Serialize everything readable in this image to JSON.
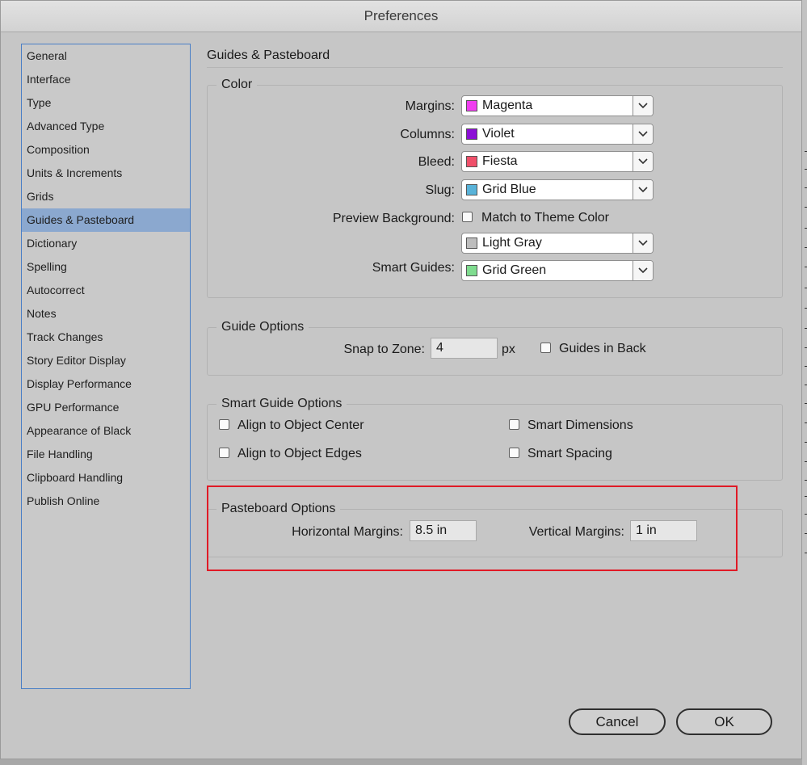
{
  "window": {
    "title": "Preferences"
  },
  "sidebar": {
    "items": [
      {
        "label": "General"
      },
      {
        "label": "Interface"
      },
      {
        "label": "Type"
      },
      {
        "label": "Advanced Type"
      },
      {
        "label": "Composition"
      },
      {
        "label": "Units & Increments"
      },
      {
        "label": "Grids"
      },
      {
        "label": "Guides & Pasteboard",
        "selected": true
      },
      {
        "label": "Dictionary"
      },
      {
        "label": "Spelling"
      },
      {
        "label": "Autocorrect"
      },
      {
        "label": "Notes"
      },
      {
        "label": "Track Changes"
      },
      {
        "label": "Story Editor Display"
      },
      {
        "label": "Display Performance"
      },
      {
        "label": "GPU Performance"
      },
      {
        "label": "Appearance of Black"
      },
      {
        "label": "File Handling"
      },
      {
        "label": "Clipboard Handling"
      },
      {
        "label": "Publish Online"
      }
    ]
  },
  "panel": {
    "title": "Guides & Pasteboard",
    "color": {
      "legend": "Color",
      "margins": {
        "label": "Margins:",
        "value": "Magenta",
        "swatch": "#f03ef0"
      },
      "columns": {
        "label": "Columns:",
        "value": "Violet",
        "swatch": "#8c0fd6"
      },
      "bleed": {
        "label": "Bleed:",
        "value": "Fiesta",
        "swatch": "#f0506a"
      },
      "slug": {
        "label": "Slug:",
        "value": "Grid Blue",
        "swatch": "#59b3d9"
      },
      "preview_background": {
        "label": "Preview Background:",
        "match_label": "Match to Theme Color",
        "match_checked": false,
        "value": "Light Gray",
        "swatch": "#bdbdbd"
      },
      "smart_guides": {
        "label": "Smart Guides:",
        "value": "Grid Green",
        "swatch": "#7fdc8f"
      }
    },
    "guide_options": {
      "legend": "Guide Options",
      "snap_label": "Snap to Zone:",
      "snap_value": "4",
      "snap_unit": "px",
      "guides_in_back_label": "Guides in Back",
      "guides_in_back_checked": false
    },
    "smart_guide_options": {
      "legend": "Smart Guide Options",
      "align_center": "Align to Object Center",
      "align_edges": "Align to Object Edges",
      "smart_dimensions": "Smart Dimensions",
      "smart_spacing": "Smart Spacing"
    },
    "pasteboard_options": {
      "legend": "Pasteboard Options",
      "horizontal_label": "Horizontal Margins:",
      "horizontal_value": "8.5 in",
      "vertical_label": "Vertical Margins:",
      "vertical_value": "1 in"
    }
  },
  "buttons": {
    "cancel": "Cancel",
    "ok": "OK"
  },
  "annotation": {
    "highlight_color": "#e01a26"
  }
}
